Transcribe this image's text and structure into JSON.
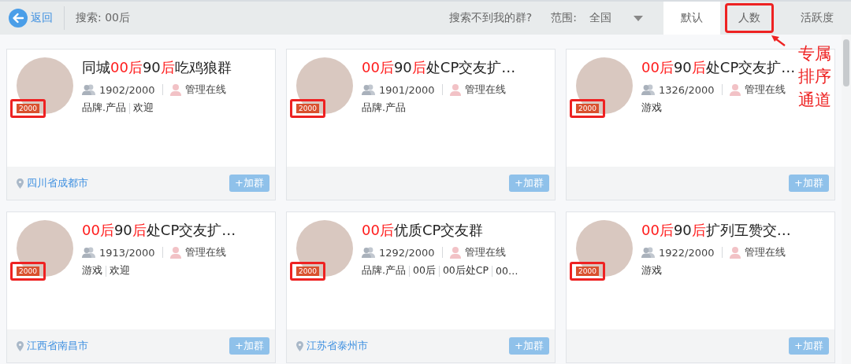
{
  "toolbar": {
    "back": "返回",
    "search": "搜索: 00后",
    "help_link": "搜索不到我的群?",
    "scope_label": "范围:",
    "scope_value": "全国"
  },
  "sort_tabs": [
    {
      "label": "默认",
      "selected": true,
      "annotated": false
    },
    {
      "label": "人数",
      "selected": false,
      "annotated": true
    },
    {
      "label": "活跃度",
      "selected": false,
      "annotated": false
    }
  ],
  "annotation": {
    "text": "专属排序通道"
  },
  "groups": [
    {
      "title": [
        {
          "text": "同城",
          "highlight": false
        },
        {
          "text": "00后",
          "highlight": true
        },
        {
          "text": "90",
          "highlight": false
        },
        {
          "text": "后",
          "highlight": true
        },
        {
          "text": "吃鸡狼群",
          "highlight": false
        }
      ],
      "badge": "2000",
      "badge_annotated": true,
      "members": "1902/2000",
      "admin": "管理在线",
      "tags": [
        "品牌.产品",
        "欢迎"
      ],
      "location": "四川省成都市",
      "join": "+加群"
    },
    {
      "title": [
        {
          "text": "00后",
          "highlight": true
        },
        {
          "text": "90",
          "highlight": false
        },
        {
          "text": "后",
          "highlight": true
        },
        {
          "text": "处CP交友扩…",
          "highlight": false
        }
      ],
      "badge": "2000",
      "badge_annotated": true,
      "members": "1901/2000",
      "admin": "管理在线",
      "tags": [
        "品牌.产品"
      ],
      "join": "+加群"
    },
    {
      "title": [
        {
          "text": "00后",
          "highlight": true
        },
        {
          "text": "90",
          "highlight": false
        },
        {
          "text": "后",
          "highlight": true
        },
        {
          "text": "处CP交友扩…",
          "highlight": false
        }
      ],
      "badge": "2000",
      "badge_annotated": true,
      "members": "1326/2000",
      "admin": "管理在线",
      "tags": [
        "游戏"
      ],
      "join": "+加群"
    },
    {
      "title": [
        {
          "text": "00后",
          "highlight": true
        },
        {
          "text": "90",
          "highlight": false
        },
        {
          "text": "后",
          "highlight": true
        },
        {
          "text": "处CP交友扩…",
          "highlight": false
        }
      ],
      "badge": "2000",
      "badge_annotated": true,
      "members": "1913/2000",
      "admin": "管理在线",
      "tags": [
        "游戏",
        "欢迎"
      ],
      "location": "江西省南昌市",
      "join": "+加群"
    },
    {
      "title": [
        {
          "text": "00后",
          "highlight": true
        },
        {
          "text": "优质CP交友群",
          "highlight": false
        }
      ],
      "badge": "2000",
      "badge_annotated": true,
      "members": "1292/2000",
      "admin": "管理在线",
      "tags": [
        "品牌.产品",
        "00后",
        "00后处CP",
        "00…"
      ],
      "location": "江苏省泰州市",
      "join": "+加群"
    },
    {
      "title": [
        {
          "text": "00后",
          "highlight": true
        },
        {
          "text": "90",
          "highlight": false
        },
        {
          "text": "后",
          "highlight": true
        },
        {
          "text": "扩列互赞交…",
          "highlight": false
        }
      ],
      "badge": "2000",
      "badge_annotated": true,
      "members": "1922/2000",
      "admin": "管理在线",
      "tags": [
        "游戏"
      ],
      "join": "+加群"
    }
  ]
}
